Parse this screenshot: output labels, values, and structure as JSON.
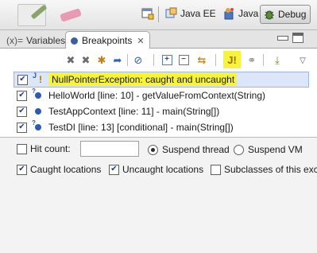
{
  "perspectives": {
    "java_ee_label": "Java EE",
    "java_label": "Java",
    "debug_label": "Debug"
  },
  "view": {
    "tabs": [
      {
        "label": "Variables",
        "prefix": "(x)="
      },
      {
        "label": "Breakpoints",
        "close": "✕"
      }
    ]
  },
  "toolbar": {
    "icons": [
      "remove-icon",
      "remove-all-icon",
      "show-supported-icon",
      "go-to-file-icon",
      "skip-all-icon",
      "expand-all-icon",
      "collapse-all-icon",
      "link-with-debug-view-icon",
      "java-exception-breakpoint-icon",
      "group-by-icon",
      "import-icon",
      "view-menu-icon"
    ]
  },
  "breakpoints": [
    {
      "label": "NullPointerException: caught and uncaught",
      "checked": true,
      "selected": true,
      "type": "exception"
    },
    {
      "label": "HelloWorld [line: 10] - getValueFromContext(String)",
      "checked": true,
      "selected": false,
      "type": "line-conditional"
    },
    {
      "label": "TestAppContext [line: 11] - main(String[])",
      "checked": true,
      "selected": false,
      "type": "line"
    },
    {
      "label": "TestDI [line: 13] [conditional] - main(String[])",
      "checked": true,
      "selected": false,
      "type": "line-conditional"
    }
  ],
  "detail": {
    "hit_count_label": "Hit count:",
    "hit_count_value": "",
    "suspend_thread_label": "Suspend thread",
    "suspend_vm_label": "Suspend VM",
    "suspend_selected": "thread",
    "caught_label": "Caught locations",
    "uncaught_label": "Uncaught locations",
    "subclasses_label": "Subclasses of this exc",
    "caught_checked": true,
    "uncaught_checked": true,
    "subclasses_checked": false
  },
  "colors": {
    "highlight": "#f6f33a",
    "selection": "#dbe7f8",
    "breakpoint": "#2d5bb1"
  }
}
